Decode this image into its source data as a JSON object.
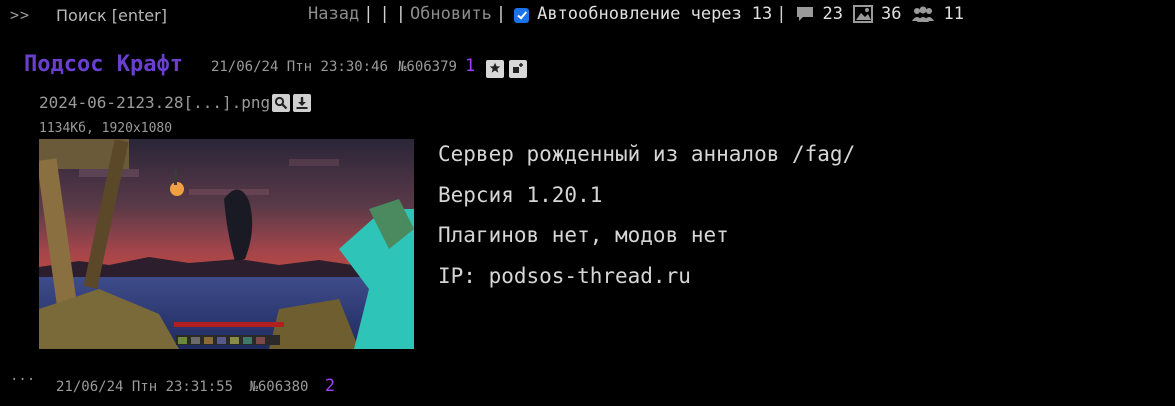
{
  "topbar": {
    "toggle": ">>",
    "search_label": "Поиск [enter]",
    "back": "Назад",
    "refresh": "Обновить",
    "autorefresh_checked": true,
    "autorefresh_label": "Автообновление через",
    "autorefresh_seconds": "13",
    "stats": {
      "posts": "23",
      "images": "36",
      "users": "11"
    },
    "icons": [
      "comment-icon",
      "image-icon",
      "users-icon"
    ]
  },
  "post": {
    "subject": "Подсос Крафт",
    "datetime": "21/06/24 Птн 23:30:46",
    "number": "№606379",
    "index": "1",
    "file": {
      "name": "2024-06-2123.28[...].png",
      "info": "1134Кб, 1920x1080"
    },
    "text_lines": [
      "Сервер рожденный из анналов /fag/",
      "Версия 1.20.1",
      "Плагинов нет, модов нет",
      "IP: podsos-thread.ru"
    ]
  },
  "post2": {
    "dots": "...",
    "datetime": "21/06/24 Птн 23:31:55",
    "number": "№606380",
    "index": "2"
  },
  "colors": {
    "background": "#000000",
    "subject": "#6a3fcf",
    "post_index": "#a040ff",
    "checkbox": "#1a73e8"
  }
}
